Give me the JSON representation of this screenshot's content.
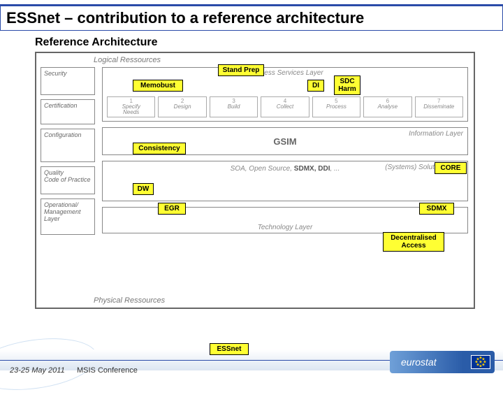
{
  "title": "ESSnet – contribution to a reference architecture",
  "ref_title": "Reference Architecture",
  "logical_label": "Logical Ressources",
  "physical_label": "Physical Ressources",
  "left": {
    "security": "Security",
    "certification": "Certification",
    "configuration": "Configuration",
    "quality": "Quality\nCode of Practice",
    "ops": "Operational/\nManagement Layer"
  },
  "layers": {
    "business": "Business Services Layer",
    "information": "Information Layer",
    "gsim": "GSIM",
    "solution": "(Systems) Solution Layer",
    "soa_prefix": "SOA, Open Source, ",
    "soa_strong": "SDMX, DDI",
    "soa_suffix": ", ...",
    "technology": "Technology Layer"
  },
  "steps": [
    {
      "n": "1",
      "l": "Specify\nNeeds"
    },
    {
      "n": "2",
      "l": "Design"
    },
    {
      "n": "3",
      "l": "Build"
    },
    {
      "n": "4",
      "l": "Collect"
    },
    {
      "n": "5",
      "l": "Process"
    },
    {
      "n": "6",
      "l": "Analyse"
    },
    {
      "n": "7",
      "l": "Disseminate"
    }
  ],
  "tags": {
    "stand_prep": "Stand Prep",
    "memobust": "Memobust",
    "di": "DI",
    "sdc_harm": "SDC\nHarm",
    "consistency": "Consistency",
    "core": "CORE",
    "dw": "DW",
    "egr": "EGR",
    "sdmx": "SDMX",
    "decentralised": "Decentralised\nAccess",
    "essnet": "ESSnet"
  },
  "footer": {
    "date": "23-25 May 2011",
    "conf": "MSIS Conference",
    "brand": "eurostat"
  }
}
